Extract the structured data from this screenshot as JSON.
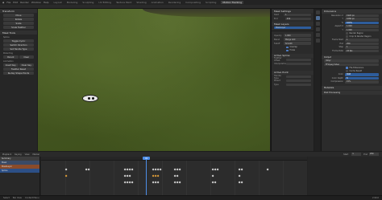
{
  "topbar": {
    "menus": [
      "File",
      "Edit",
      "Render",
      "Window",
      "Help"
    ],
    "workspaces": [
      "Layout",
      "Modeling",
      "Sculpting",
      "UV Editing",
      "Texture Paint",
      "Shading",
      "Animation",
      "Rendering",
      "Compositing",
      "Scripting",
      "Motion Tracking"
    ],
    "active_workspace": "Motion Tracking"
  },
  "toolbox": {
    "sections": [
      {
        "title": "Transform",
        "buttons": [
          "Move",
          "Rotate",
          "Scale",
          "Scale Feather"
        ]
      },
      {
        "title": "Mask Tools",
        "sub": "Spline",
        "buttons": [
          "Toggle Cyclic",
          "Switch Direction",
          "Set Handle Type"
        ]
      },
      {
        "title": "Parenting",
        "buttons": [
          "Parent",
          "Clear"
        ]
      },
      {
        "title": "Animation",
        "buttons": [
          "Insert Key",
          "Clear Key",
          "Feather Reset",
          "Re-Key Shape Points"
        ]
      }
    ]
  },
  "props": {
    "mask_settings_title": "Mask Settings",
    "start_label": "Start",
    "start_value": "1",
    "end_label": "End",
    "end_value": "250",
    "mask_layers_title": "Mask Layers",
    "layer_name": "MaskLayer",
    "layer_rows": [
      {
        "label": "Opacity",
        "value": "1.000"
      },
      {
        "label": "Blend",
        "value": "Merge Add"
      },
      {
        "label": "Falloff",
        "value": "Smooth"
      }
    ],
    "overlap_label": "Overlap",
    "holes_label": "Holes",
    "active_spline_title": "Active Spline",
    "spline_rows": [
      "Feather Offset",
      "Interpolation"
    ],
    "active_point_title": "Active Point",
    "point_rows": [
      "Handle Type",
      "Parent",
      "Type"
    ]
  },
  "right_panel": {
    "dimensions_title": "Dimensions",
    "dim_rows": [
      {
        "label": "Resolution X",
        "value": "1920 px"
      },
      {
        "label": "Y",
        "value": "1080 px"
      },
      {
        "label": "%",
        "value": "100%"
      },
      {
        "label": "Aspect X",
        "value": "1.000"
      },
      {
        "label": "Y",
        "value": "1.000"
      }
    ],
    "render_region": "Render Region",
    "crop_region": "Crop to Render Region",
    "frame_rows": [
      {
        "label": "Frame Start",
        "value": "1"
      },
      {
        "label": "End",
        "value": "250"
      },
      {
        "label": "Step",
        "value": "1"
      }
    ],
    "frame_rate_label": "Frame Rate",
    "frame_rate_value": "24 fps",
    "output_title": "Output",
    "output_path": "/tmp/",
    "file_format": "FFmpeg Video",
    "output_checks": [
      {
        "label": "File Extensions",
        "on": true
      },
      {
        "label": "Cache Result",
        "on": false
      }
    ],
    "image_rows": [
      {
        "label": "Color",
        "value": "RGB"
      },
      {
        "label": "Color Depth",
        "value": "8"
      },
      {
        "label": "Compression",
        "value": "15%"
      }
    ],
    "sections": [
      "Metadata",
      "Post Processing"
    ]
  },
  "timeline": {
    "menus": [
      "Playback",
      "Keying",
      "View",
      "Marker"
    ],
    "channels": [
      "Summary",
      "Mask",
      "MaskLayer",
      "Spline"
    ],
    "frame_label": "49",
    "start_label": "Start",
    "start": "1",
    "end_label": "End",
    "end": "250"
  },
  "status": {
    "items": [
      "Select",
      "Pan View",
      "Context Menu"
    ],
    "version": "2.90.0"
  },
  "colors": {
    "accent": "#4d8ee8",
    "selected_keyframe": "#e8a33a",
    "checkbox": "#4d7ac0"
  }
}
